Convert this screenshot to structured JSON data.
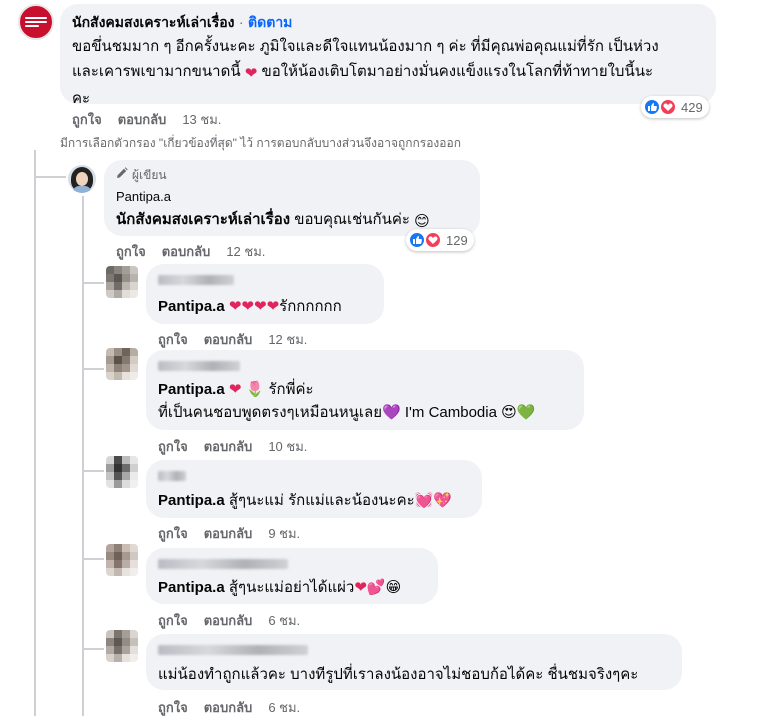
{
  "main_comment": {
    "author": "นักสังคมสงเคราะห์เล่าเรื่อง",
    "separator": "·",
    "follow_label": "ติดตาม",
    "line1": "ขอขึ่นชมมาก ๆ อีกครั้งนะคะ ภูมิใจและดีใจแทนน้องมาก ๆ ค่ะ ที่มีคุณพ่อคุณแม่ที่รัก เป็นห่วง",
    "line2a": "และเคารพเขามากขนาดนี้",
    "line2b": "ขอให้น้องเติบโตมาอย่างมั่นคงแข็งแรงในโลกที่ท้าทายใบนี้นะ",
    "line3": "คะ",
    "reaction_count": "429",
    "like_label": "ถูกใจ",
    "reply_label": "ตอบกลับ",
    "time": "13 ชม."
  },
  "filter_notice": "มีการเลือกตัวกรอง \"เกี่ยวข้องที่สุด\" ไว้ การตอบกลับบางส่วนจึงอาจถูกกรองออก",
  "author_reply": {
    "author_tag": "ผู้เขียน",
    "name": "Pantipa.a",
    "mention": "นักสังคมสงเคราะห์เล่าเรื่อง",
    "text": "ขอบคุณเช่นกันค่ะ",
    "reaction_count": "129",
    "like_label": "ถูกใจ",
    "reply_label": "ตอบกลับ",
    "time": "12 ชม."
  },
  "replies": [
    {
      "mention": "Pantipa.a",
      "text": "รักกกกกก",
      "like_label": "ถูกใจ",
      "reply_label": "ตอบกลับ",
      "time": "12 ชม."
    },
    {
      "mention": "Pantipa.a",
      "text1": "รักพี่ค่ะ",
      "text2": "ที่เป็นคนชอบพูดตรงๆเหมือนหนูเลย",
      "text3": "I'm Cambodia",
      "like_label": "ถูกใจ",
      "reply_label": "ตอบกลับ",
      "time": "10 ชม."
    },
    {
      "mention": "Pantipa.a",
      "text": "สู้ๆนะแม่ รักแม่และน้องนะคะ",
      "like_label": "ถูกใจ",
      "reply_label": "ตอบกลับ",
      "time": "9 ชม."
    },
    {
      "mention": "Pantipa.a",
      "text": "สู้ๆนะแม่อย่าได้แผ่ว",
      "like_label": "ถูกใจ",
      "reply_label": "ตอบกลับ",
      "time": "6 ชม."
    },
    {
      "text": "แม่น้องทำถูกแล้วคะ บางทีรูปที่เราลงน้องอาจไม่ชอบก้อได้คะ ชื่นชมจริงๆคะ",
      "like_label": "ถูกใจ",
      "reply_label": "ตอบกลับ",
      "time": "6 ชม."
    }
  ],
  "colors": {
    "bubble": "#f0f2f5",
    "link_blue": "#0866ff",
    "meta_gray": "#65676b",
    "like_blue": "#1877f2",
    "love_red": "#f33e58"
  },
  "icons": [
    "page-avatar",
    "pencil-icon",
    "like-reaction-icon",
    "love-reaction-icon",
    "heart-emoji",
    "smile-emoji"
  ]
}
